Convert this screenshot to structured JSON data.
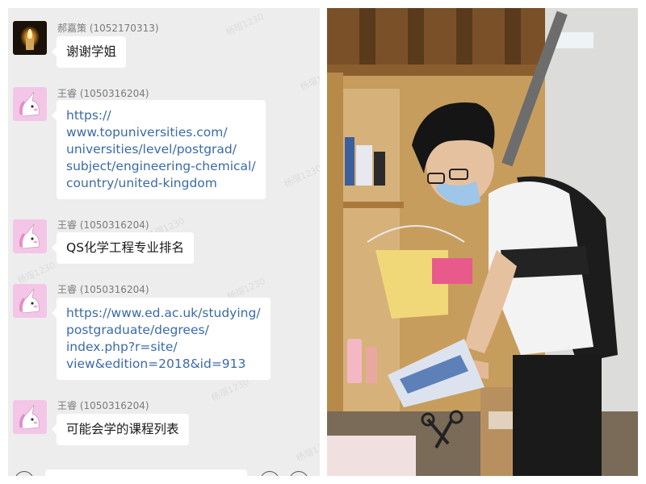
{
  "chat": {
    "messages": [
      {
        "sender": "郝嘉策 (1052170313)",
        "avatar": "candle-avatar",
        "lines": [
          "谢谢学姐"
        ],
        "is_link": false
      },
      {
        "sender": "王睿 (1050316204)",
        "avatar": "unicorn-avatar",
        "lines": [
          "https://",
          "www.topuniversities.com/",
          "universities/level/postgrad/",
          "subject/engineering-chemical/",
          "country/united-kingdom"
        ],
        "is_link": true
      },
      {
        "sender": "王睿 (1050316204)",
        "avatar": "unicorn-avatar",
        "lines": [
          "QS化学工程专业排名"
        ],
        "is_link": false
      },
      {
        "sender": "王睿 (1050316204)",
        "avatar": "unicorn-avatar",
        "lines": [
          "https://www.ed.ac.uk/studying/",
          "postgraduate/degrees/",
          "index.php?r=site/",
          "view&edition=2018&id=913"
        ],
        "is_link": true
      },
      {
        "sender": "王睿 (1050316204)",
        "avatar": "unicorn-avatar",
        "lines": [
          "可能会学的课程列表"
        ],
        "is_link": false
      }
    ],
    "watermark": "杨瑁1230",
    "colors": {
      "background": "#ededed",
      "bubble": "#ffffff",
      "link": "#3b6aa8",
      "sender": "#7a7a7a"
    }
  },
  "photo": {
    "caption": ""
  }
}
